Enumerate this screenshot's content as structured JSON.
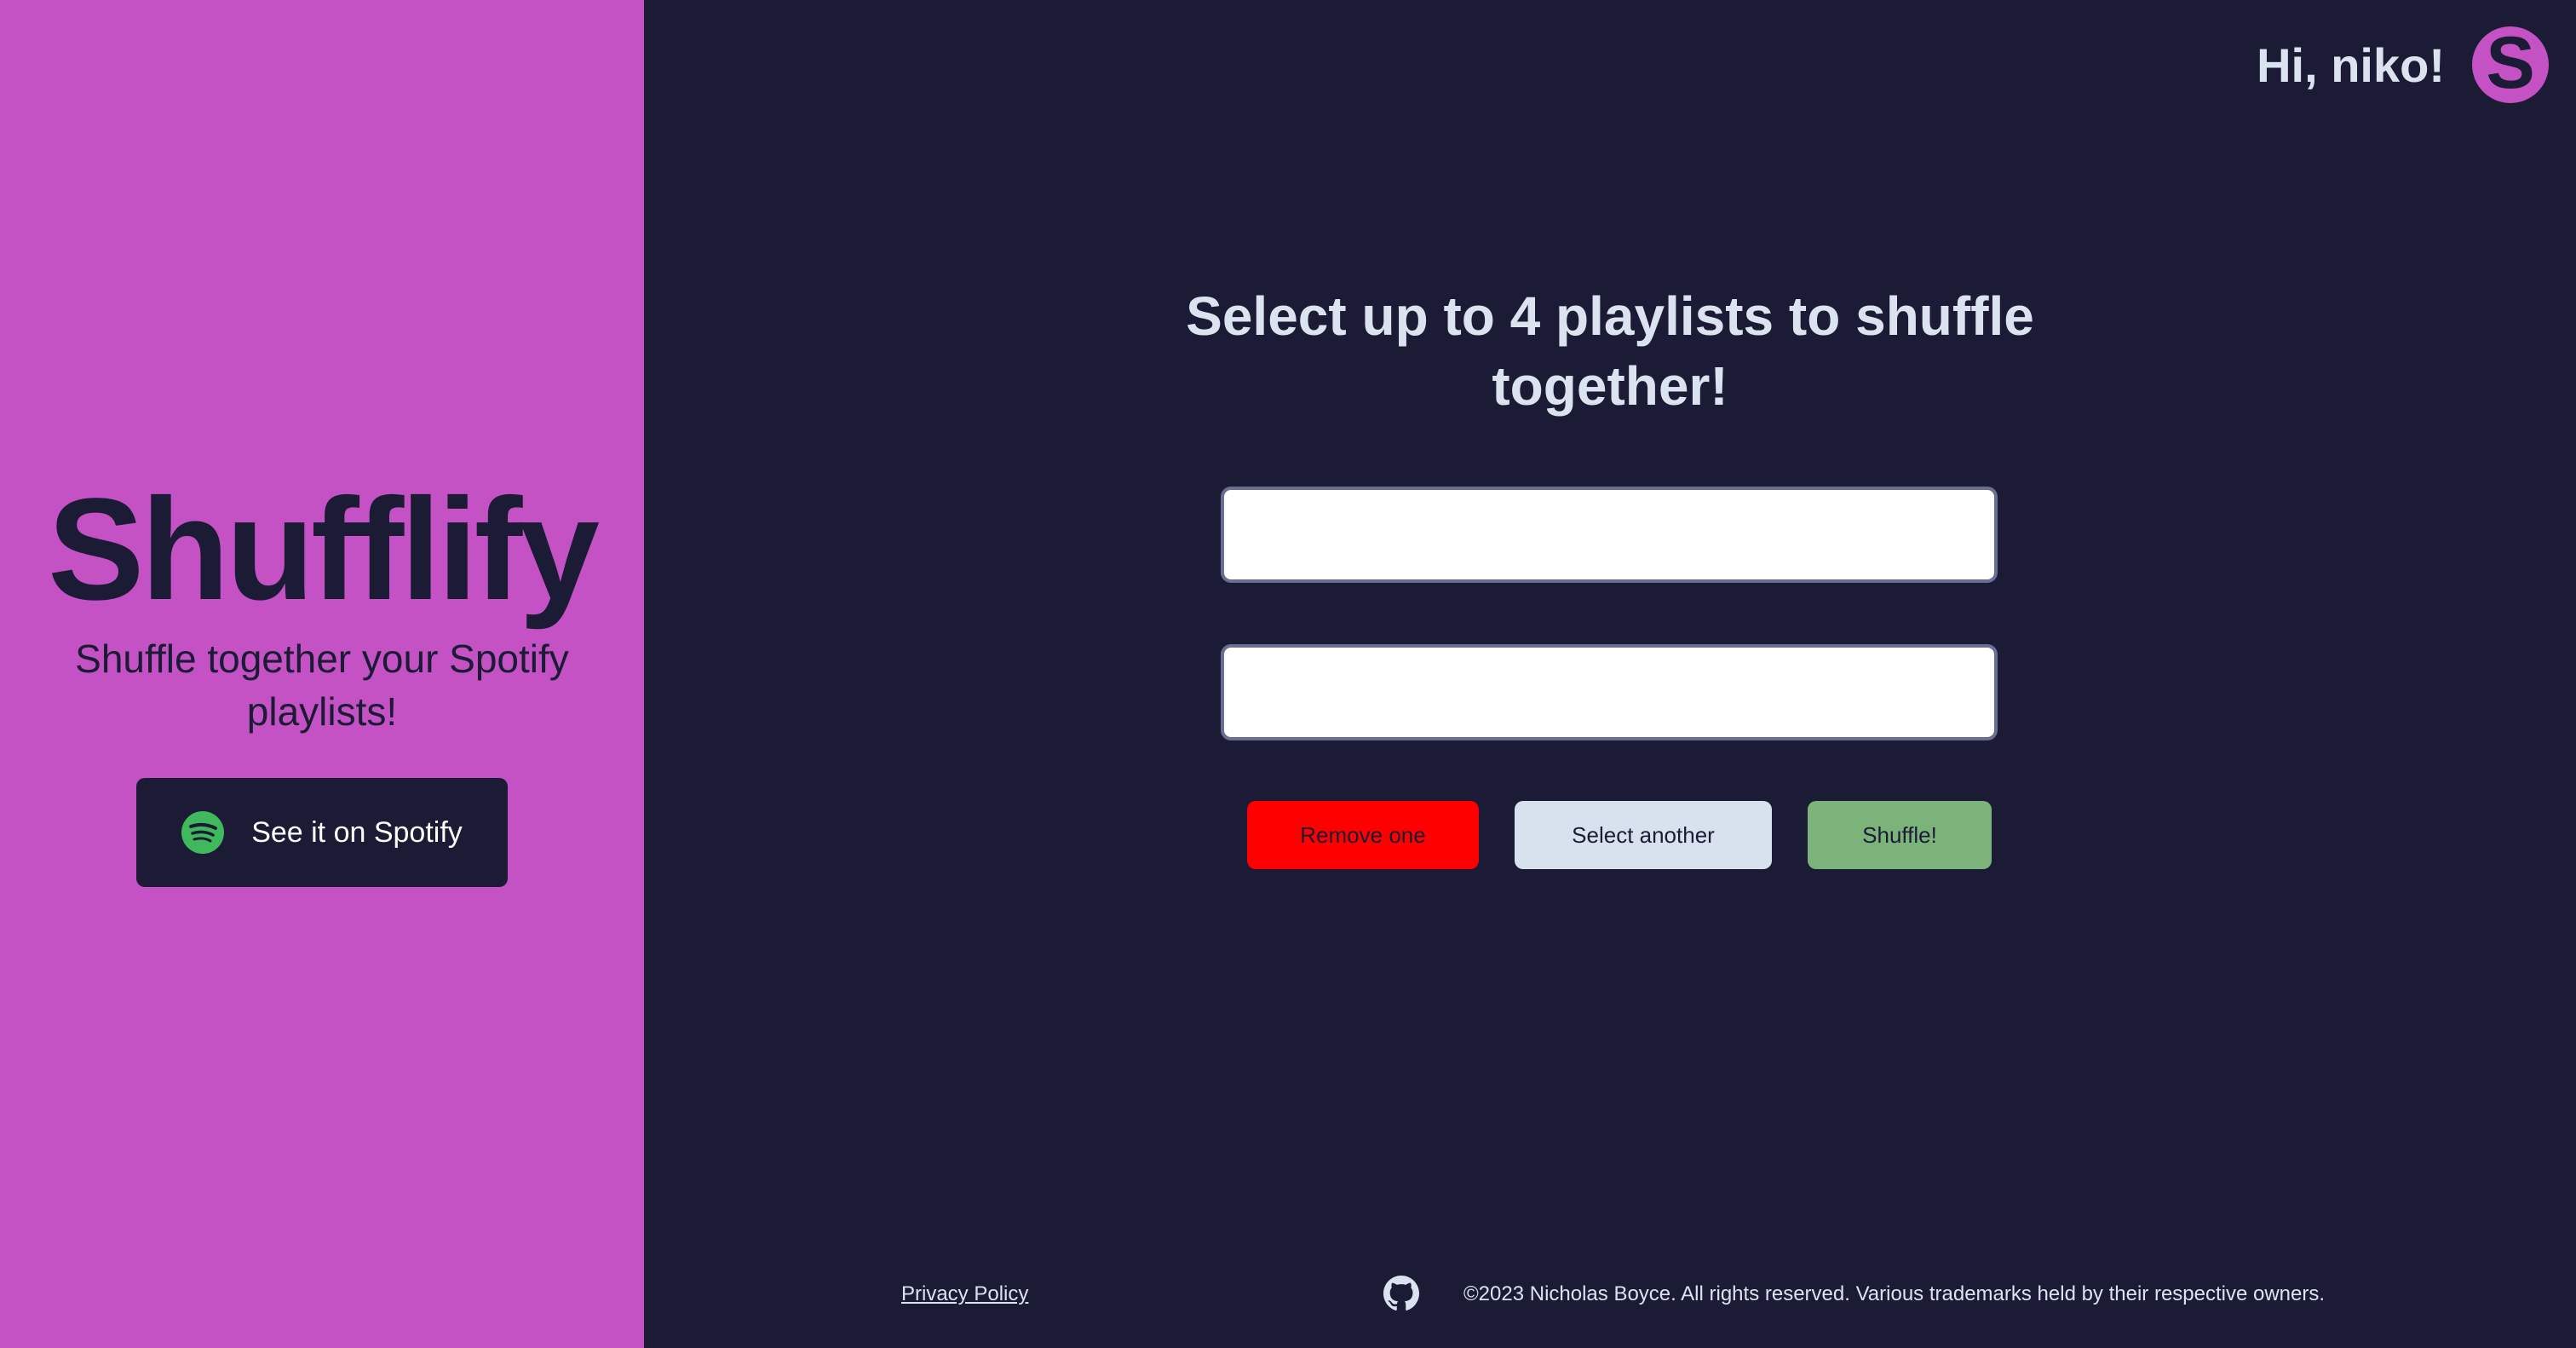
{
  "sidebar": {
    "brand_title": "Shufflify",
    "tagline": "Shuffle together your Spotify playlists!",
    "spotify_button_label": "See it on Spotify",
    "spotify_icon": "spotify-icon"
  },
  "header": {
    "greeting": "Hi, niko!",
    "avatar_letter": "S"
  },
  "main": {
    "heading": "Select up to 4 playlists to shuffle together!",
    "playlist_inputs": [
      {
        "value": ""
      },
      {
        "value": ""
      }
    ],
    "buttons": {
      "remove": "Remove one",
      "select_another": "Select another",
      "shuffle": "Shuffle!"
    }
  },
  "footer": {
    "privacy_link": "Privacy Policy",
    "github_icon": "github-icon",
    "copyright": "©2023 Nicholas Boyce. All rights reserved. Various trademarks held by their respective owners."
  },
  "colors": {
    "brand_purple": "#c452c5",
    "dark_navy": "#1b1b36",
    "remove_red": "#ff0000",
    "select_gray": "#d8e1ee",
    "shuffle_green": "#7bb37a",
    "text_light": "#dce3f0"
  }
}
